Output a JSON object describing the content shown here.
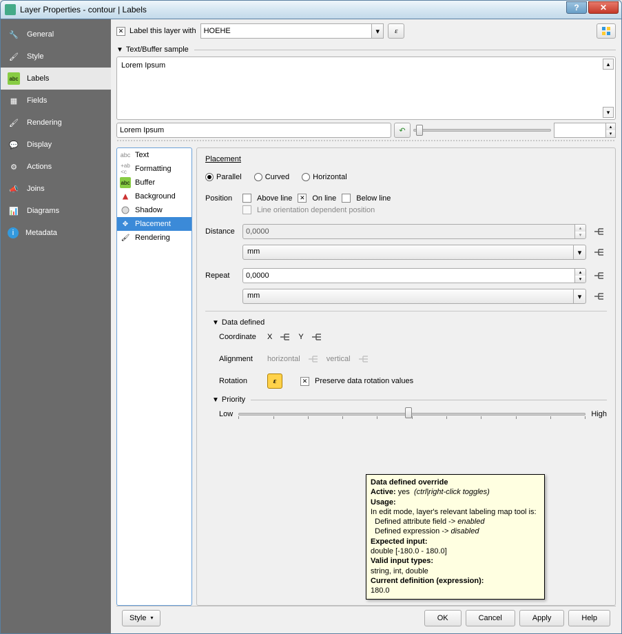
{
  "window": {
    "title": "Layer Properties - contour | Labels"
  },
  "sidebar": {
    "items": [
      {
        "label": "General"
      },
      {
        "label": "Style"
      },
      {
        "label": "Labels"
      },
      {
        "label": "Fields"
      },
      {
        "label": "Rendering"
      },
      {
        "label": "Display"
      },
      {
        "label": "Actions"
      },
      {
        "label": "Joins"
      },
      {
        "label": "Diagrams"
      },
      {
        "label": "Metadata"
      }
    ],
    "active_index": 2
  },
  "top": {
    "checkbox_label": "Label this layer with",
    "field_value": "HOEHE",
    "expr_button": "ε"
  },
  "sample": {
    "header": "Text/Buffer sample",
    "text": "Lorem Ipsum",
    "input": "Lorem Ipsum"
  },
  "sublist": {
    "items": [
      {
        "label": "Text"
      },
      {
        "label": "Formatting"
      },
      {
        "label": "Buffer"
      },
      {
        "label": "Background"
      },
      {
        "label": "Shadow"
      },
      {
        "label": "Placement"
      },
      {
        "label": "Rendering"
      }
    ],
    "active_index": 5
  },
  "placement": {
    "title": "Placement",
    "mode": {
      "parallel": "Parallel",
      "curved": "Curved",
      "horizontal": "Horizontal",
      "selected": "parallel"
    },
    "position": {
      "label": "Position",
      "above": "Above line",
      "on": "On line",
      "below": "Below line",
      "orientation": "Line orientation dependent position",
      "above_checked": false,
      "on_checked": true,
      "below_checked": false,
      "orientation_checked": false
    },
    "distance": {
      "label": "Distance",
      "value": "0,0000",
      "unit": "mm"
    },
    "repeat": {
      "label": "Repeat",
      "value": "0,0000",
      "unit": "mm"
    },
    "data_defined": {
      "header": "Data defined",
      "coordinate": "Coordinate",
      "x": "X",
      "y": "Y",
      "alignment": "Alignment",
      "horizontal": "horizontal",
      "vertical": "vertical",
      "rotation": "Rotation",
      "preserve": "Preserve data rotation values",
      "preserve_checked": true
    },
    "priority": {
      "header": "Priority",
      "low": "Low",
      "high": "High"
    }
  },
  "tooltip": {
    "title": "Data defined override",
    "active_label": "Active:",
    "active_value": "yes",
    "active_hint": "(ctrl|right-click toggles)",
    "usage_label": "Usage:",
    "usage_line1": "In edit mode, layer's relevant labeling map tool is:",
    "usage_line2a": "Defined attribute field ->",
    "usage_line2b": "enabled",
    "usage_line3a": "Defined expression ->",
    "usage_line3b": "disabled",
    "expected_label": "Expected input:",
    "expected_value": "double [-180.0 - 180.0]",
    "valid_label": "Valid input types:",
    "valid_value": "string, int, double",
    "current_label": "Current definition (expression):",
    "current_value": "180.0"
  },
  "buttons": {
    "style": "Style",
    "ok": "OK",
    "cancel": "Cancel",
    "apply": "Apply",
    "help": "Help"
  }
}
